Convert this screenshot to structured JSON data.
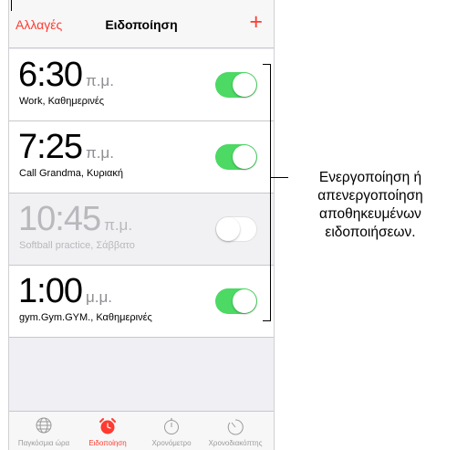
{
  "navbar": {
    "edit_label": "Αλλαγές",
    "title": "Ειδοποίηση",
    "add_label": "+"
  },
  "alarms": [
    {
      "time": "6:30",
      "ampm": "π.μ.",
      "label": "Work, Καθημερινές",
      "enabled": true
    },
    {
      "time": "7:25",
      "ampm": "π.μ.",
      "label": "Call Grandma, Κυριακή",
      "enabled": true
    },
    {
      "time": "10:45",
      "ampm": "π.μ.",
      "label": "Softball practice, Σάββατο",
      "enabled": false
    },
    {
      "time": "1:00",
      "ampm": "μ.μ.",
      "label": "gym.Gym.GYM., Καθημερινές",
      "enabled": true
    }
  ],
  "tabs": [
    {
      "label": "Παγκόσμια ώρα",
      "icon": "globe-icon",
      "active": false
    },
    {
      "label": "Ειδοποίηση",
      "icon": "alarm-clock-icon",
      "active": true
    },
    {
      "label": "Χρονόμετρο",
      "icon": "stopwatch-icon",
      "active": false
    },
    {
      "label": "Χρονοδιακόπτης",
      "icon": "timer-icon",
      "active": false
    }
  ],
  "callout": {
    "text": "Ενεργοποίηση ή απενεργοποίηση αποθηκευμένων ειδοποιήσεων."
  },
  "colors": {
    "accent": "#ff3b30",
    "switch_on": "#4cd964"
  }
}
